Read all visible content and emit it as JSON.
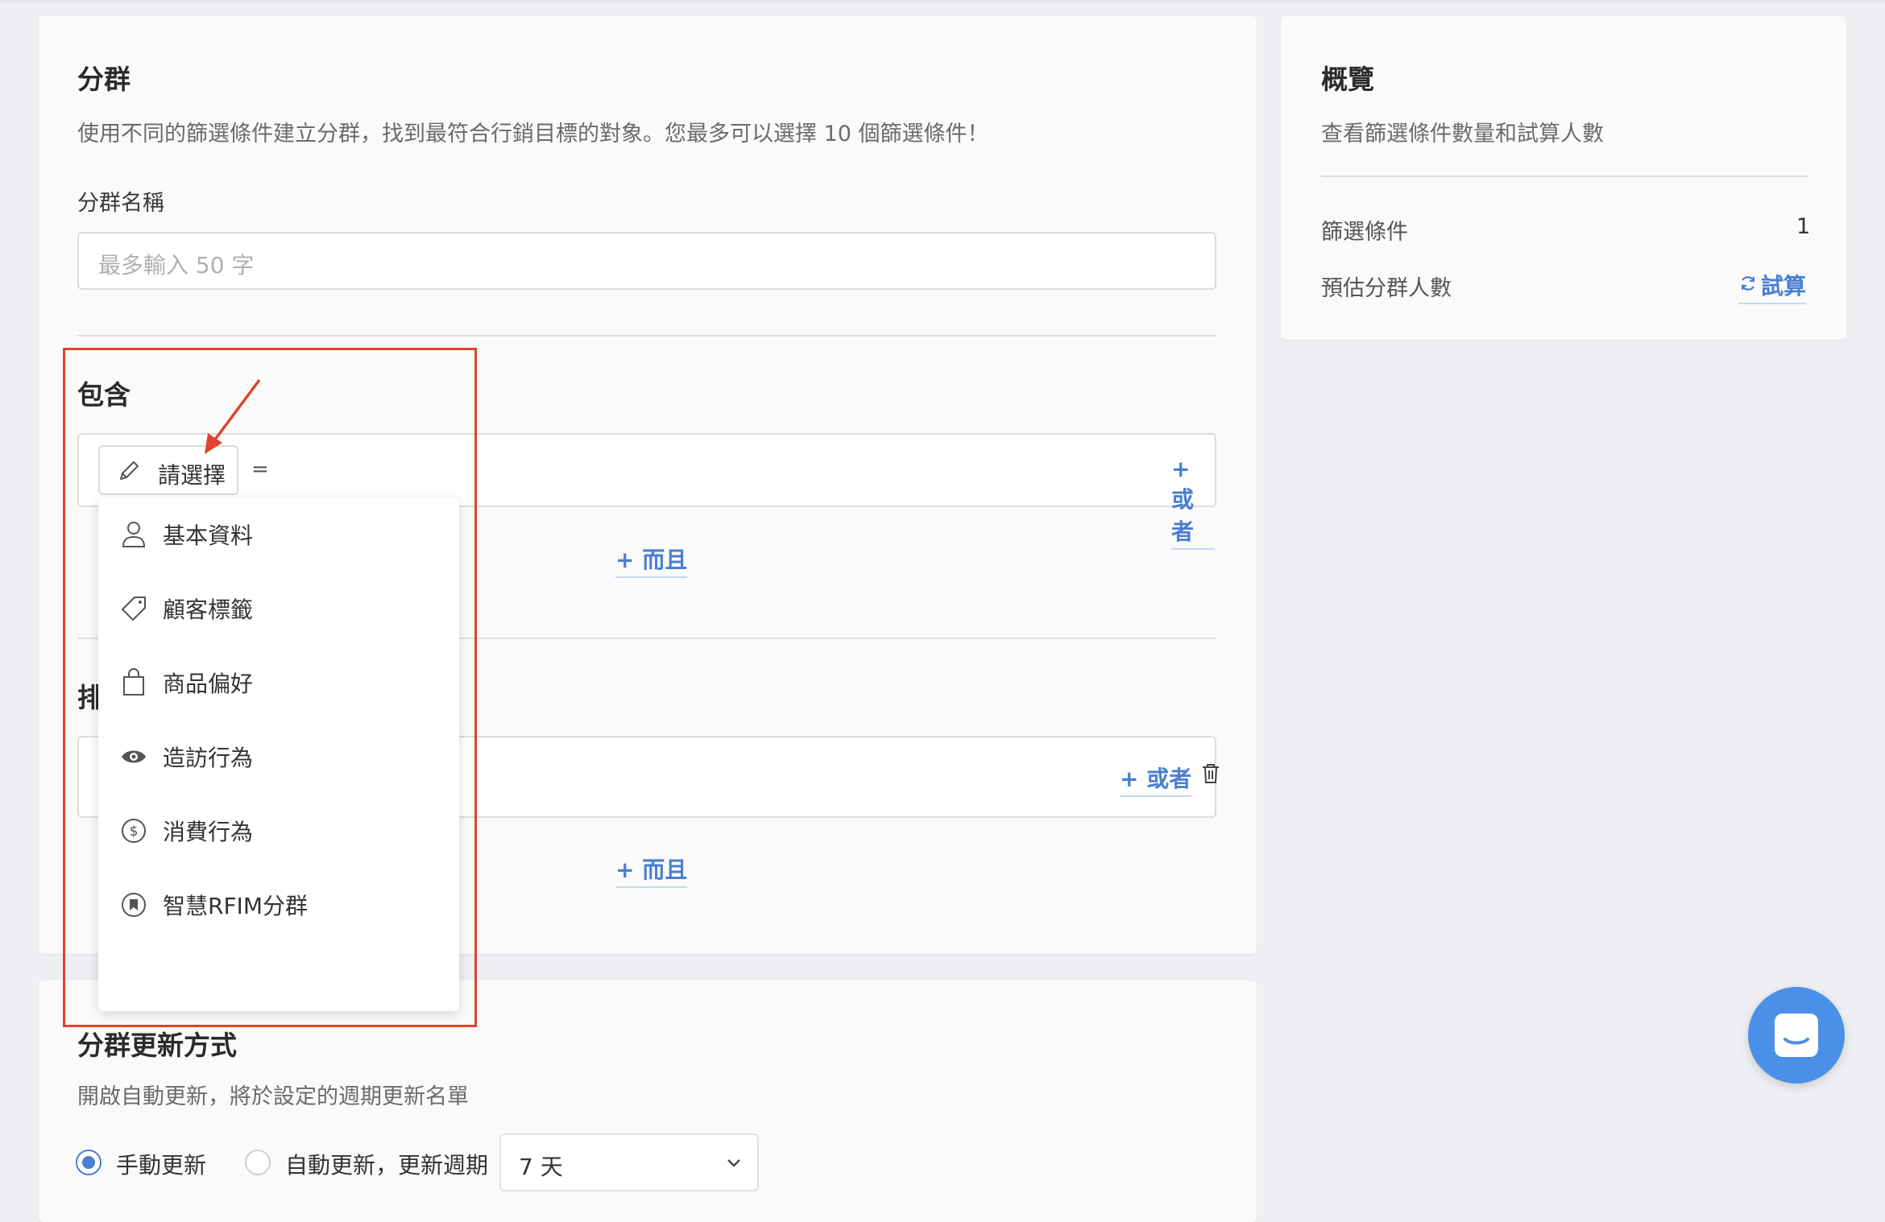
{
  "segment": {
    "title": "分群",
    "description": "使用不同的篩選條件建立分群，找到最符合行銷目標的對象。您最多可以選擇 10 個篩選條件！",
    "name_label": "分群名稱",
    "name_placeholder": "最多輸入 50 字"
  },
  "include": {
    "title": "包含",
    "select_label": "請選擇",
    "equals": "=",
    "or_label": "+ 或者",
    "and_label": "+ 而且"
  },
  "exclude": {
    "title_partial": "排",
    "or_label": "+ 或者",
    "and_label": "+ 而且"
  },
  "dropdown": {
    "items": [
      {
        "label": "基本資料",
        "icon": "person-icon"
      },
      {
        "label": "顧客標籤",
        "icon": "tag-icon"
      },
      {
        "label": "商品偏好",
        "icon": "shopping-bag-icon"
      },
      {
        "label": "造訪行為",
        "icon": "eye-icon"
      },
      {
        "label": "消費行為",
        "icon": "dollar-circle-icon"
      },
      {
        "label": "智慧RFIM分群",
        "icon": "bookmark-circle-icon"
      }
    ]
  },
  "update": {
    "title": "分群更新方式",
    "description": "開啟自動更新，將於設定的週期更新名單",
    "manual_label": "手動更新",
    "auto_label": "自動更新，更新週期",
    "period_value": "7 天"
  },
  "overview": {
    "title": "概覽",
    "description": "查看篩選條件數量和試算人數",
    "filter_count_label": "篩選條件",
    "filter_count_value": "1",
    "estimate_label": "預估分群人數",
    "calc_label": "試算"
  },
  "colors": {
    "accent": "#4a7fd0",
    "highlight_box": "#e0432f",
    "chat_button": "#4a90e8"
  }
}
